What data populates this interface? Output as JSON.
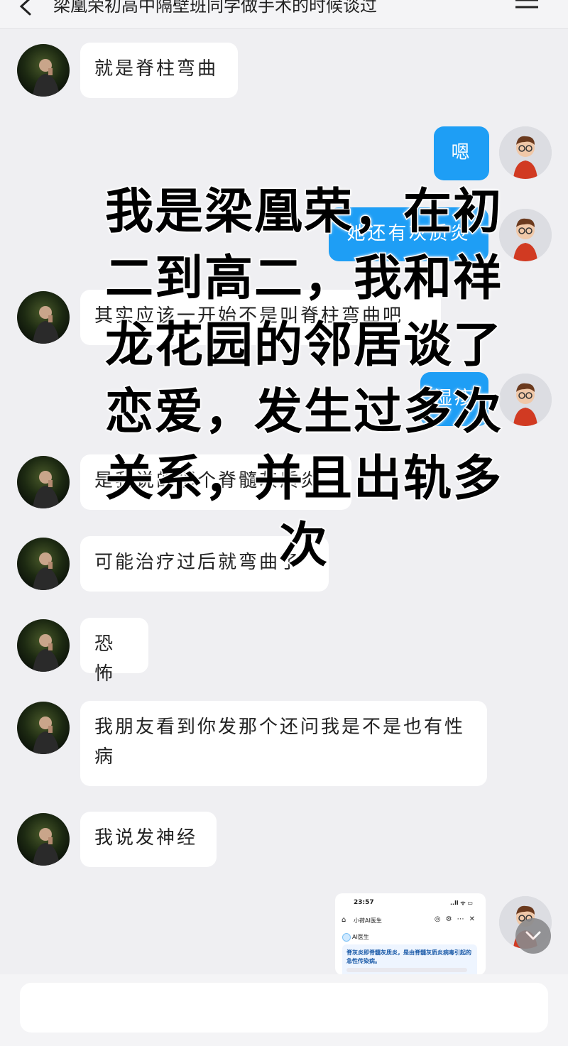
{
  "header": {
    "title": "梁凰荣初高中隔壁班同学做手术的时候谈过",
    "back_icon": "chevron-left-icon",
    "menu_icon": "hamburger-menu-icon"
  },
  "messages": [
    {
      "side": "in",
      "text": "就是脊柱弯曲"
    },
    {
      "side": "out",
      "text": "嗯"
    },
    {
      "side": "out",
      "text": "她还有灰质炎"
    },
    {
      "side": "in",
      "text": "其实应该一开始不是叫脊柱弯曲吧"
    },
    {
      "side": "out",
      "text": "湿疹"
    },
    {
      "side": "in",
      "text": "是我说的那个脊髓灰质炎"
    },
    {
      "side": "in",
      "text": "可能治疗过后就弯曲了"
    },
    {
      "side": "in",
      "text": "恐怖"
    },
    {
      "side": "in",
      "text": "我朋友看到你发那个还问我是不是也有性病"
    },
    {
      "side": "in",
      "text": "我说发神经"
    }
  ],
  "overlay_caption": "我是梁凰荣，在初二到高二，我和祥龙花园的邻居谈了恋爱，发生过多次关系，并且出轨多次",
  "screenshot_message": {
    "time": "23:57",
    "status": "..ll ᯤ ▭",
    "app_title": "小荷AI医生",
    "ai_label": "AI医生",
    "answer": "脊灰炎即脊髓灰质炎，是由脊髓灰质炎病毒引起的急性传染病。"
  },
  "colors": {
    "outgoing_bubble": "#1e9ef5",
    "incoming_bubble": "#ffffff",
    "background": "#efeff2"
  },
  "scroll_button_icon": "chevron-down-icon"
}
